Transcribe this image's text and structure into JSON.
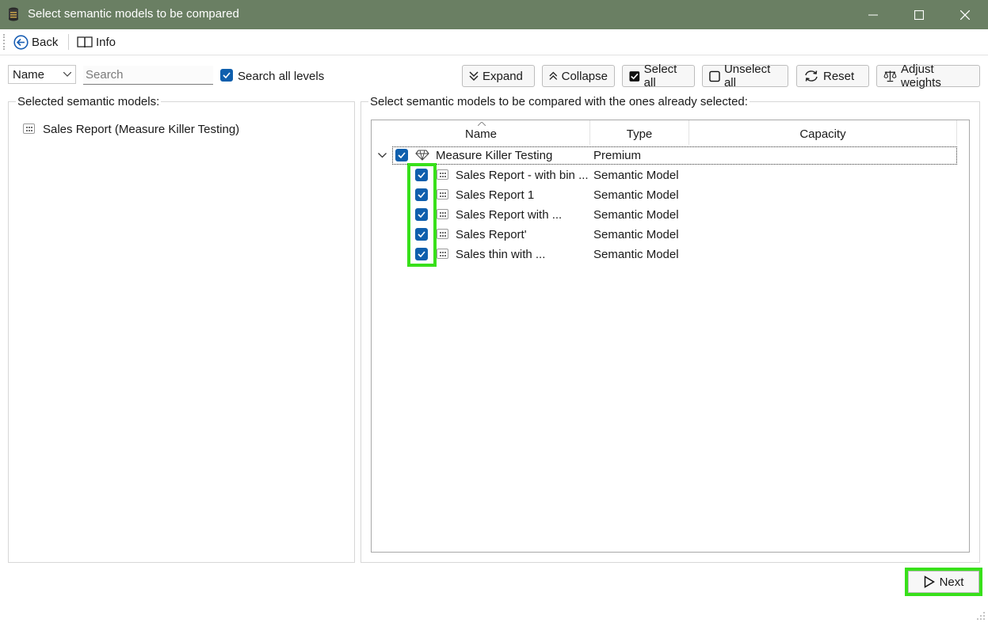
{
  "window": {
    "title": "Select semantic models to be compared",
    "titlebar_color": "#6a7f63"
  },
  "menu": {
    "back_label": "Back",
    "info_label": "Info"
  },
  "toolbar": {
    "field_select_value": "Name",
    "search_placeholder": "Search",
    "search_all_levels_label": "Search all levels",
    "search_all_levels_checked": true,
    "expand_label": "Expand",
    "collapse_label": "Collapse",
    "select_all_label": "Select all",
    "unselect_all_label": "Unselect all",
    "reset_label": "Reset",
    "adjust_weights_label": "Adjust weights"
  },
  "left_panel": {
    "title": "Selected semantic models:",
    "items": [
      {
        "label": "Sales Report (Measure Killer Testing)"
      }
    ]
  },
  "right_panel": {
    "title": "Select semantic models to be compared with the ones already selected:",
    "columns": [
      "Name",
      "Type",
      "Capacity"
    ],
    "workspace": {
      "name": "Measure Killer Testing",
      "type": "Premium",
      "capacity": "",
      "checked": true,
      "expanded": true
    },
    "models": [
      {
        "name": "Sales Report - with bin ...",
        "type": "Semantic Model",
        "checked": true
      },
      {
        "name": "Sales Report 1",
        "type": "Semantic Model",
        "checked": true
      },
      {
        "name": "Sales Report with ...",
        "type": "Semantic Model",
        "checked": true
      },
      {
        "name": "Sales Report'",
        "type": "Semantic Model",
        "checked": true
      },
      {
        "name": "Sales thin with ...",
        "type": "Semantic Model",
        "checked": true
      }
    ]
  },
  "footer": {
    "next_label": "Next"
  },
  "colors": {
    "checkbox_blue": "#0f5fad",
    "highlight_green": "#38e01a"
  }
}
